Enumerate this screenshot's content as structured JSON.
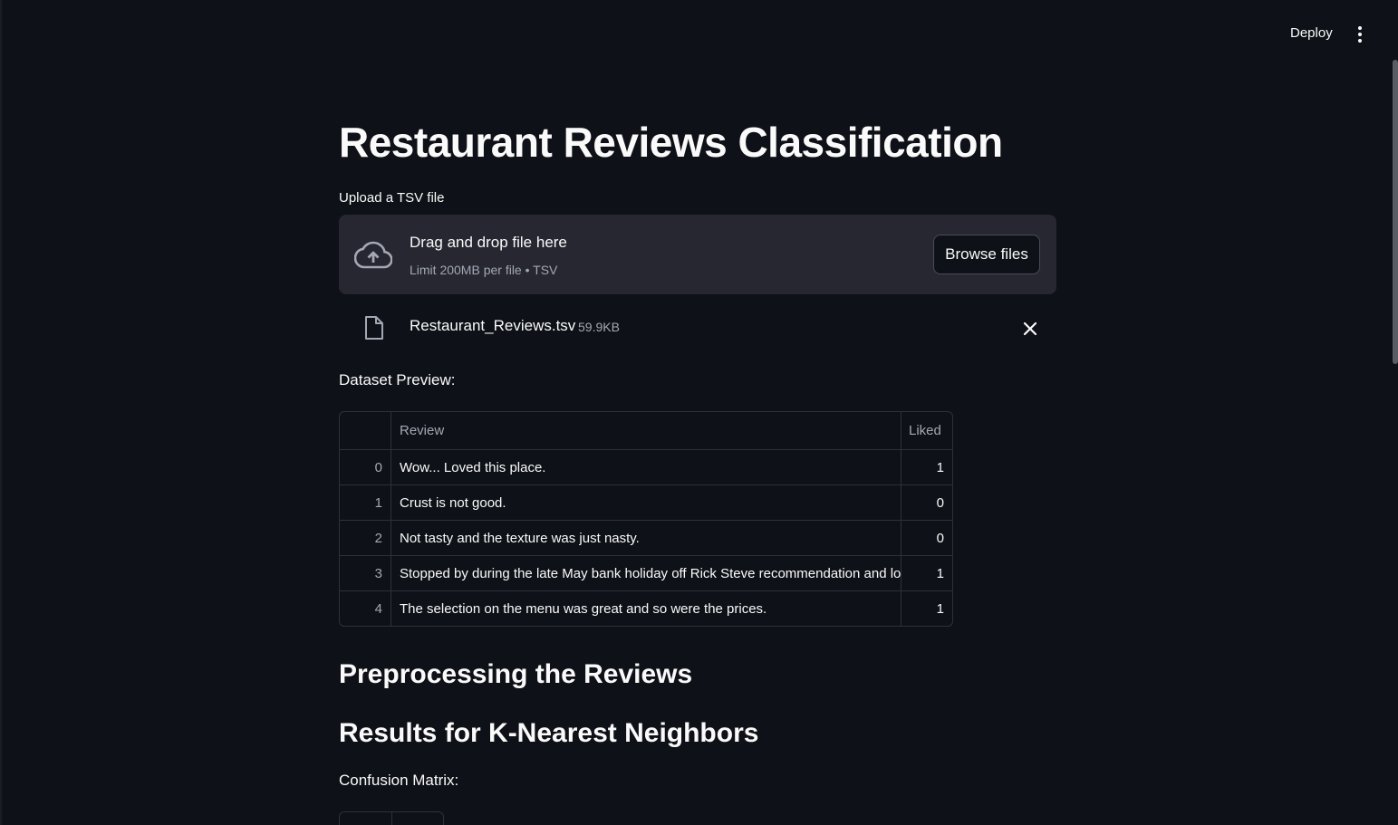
{
  "header": {
    "deploy_label": "Deploy",
    "menu_icon": "kebab-menu-icon"
  },
  "page": {
    "title": "Restaurant Reviews Classification"
  },
  "uploader": {
    "label": "Upload a TSV file",
    "drop_title": "Drag and drop file here",
    "drop_subtitle": "Limit 200MB per file • TSV",
    "browse_label": "Browse files",
    "icon": "cloud-upload-icon"
  },
  "uploaded_file": {
    "name": "Restaurant_Reviews.tsv",
    "size": "59.9KB",
    "icon": "file-icon",
    "remove_icon": "close-icon"
  },
  "preview": {
    "label": "Dataset Preview:",
    "columns": [
      "",
      "Review",
      "Liked"
    ],
    "rows": [
      {
        "index": "0",
        "review": "Wow... Loved this place.",
        "liked": "1"
      },
      {
        "index": "1",
        "review": "Crust is not good.",
        "liked": "0"
      },
      {
        "index": "2",
        "review": "Not tasty and the texture was just nasty.",
        "liked": "0"
      },
      {
        "index": "3",
        "review": "Stopped by during the late May bank holiday off Rick Steve recommendation and loved it.",
        "liked": "1"
      },
      {
        "index": "4",
        "review": "The selection on the menu was great and so were the prices.",
        "liked": "1"
      }
    ]
  },
  "sections": {
    "preprocessing": "Preprocessing the Reviews",
    "knn_results": "Results for K-Nearest Neighbors",
    "confusion_label": "Confusion Matrix:"
  },
  "colors": {
    "background": "#0e1117",
    "panel": "#262730",
    "text": "#fafafa",
    "muted": "#a3a8b4",
    "border": "#2e313a"
  }
}
